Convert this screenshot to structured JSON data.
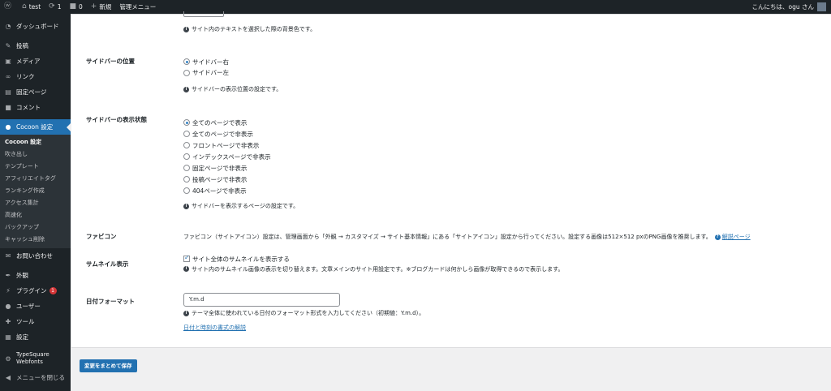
{
  "adminbar": {
    "site_name": "test",
    "updates_count": "1",
    "comments_count": "0",
    "new_label": "新規",
    "manage_menu_label": "管理メニュー",
    "greeting": "こんにちは、ogu さん"
  },
  "sidebar": {
    "items": [
      {
        "label": "ダッシュボード",
        "icon": "dashboard-icon"
      },
      {
        "label": "投稿",
        "icon": "pin-icon"
      },
      {
        "label": "メディア",
        "icon": "media-icon"
      },
      {
        "label": "リンク",
        "icon": "link-icon"
      },
      {
        "label": "固定ページ",
        "icon": "page-icon"
      },
      {
        "label": "コメント",
        "icon": "comment-icon"
      },
      {
        "label": "Cocoon 設定",
        "icon": "cocoon-icon"
      },
      {
        "label": "お問い合わせ",
        "icon": "mail-icon"
      },
      {
        "label": "外観",
        "icon": "appearance-icon"
      },
      {
        "label": "プラグイン",
        "icon": "plugin-icon",
        "badge": "1"
      },
      {
        "label": "ユーザー",
        "icon": "user-icon"
      },
      {
        "label": "ツール",
        "icon": "tools-icon"
      },
      {
        "label": "設定",
        "icon": "settings-icon"
      },
      {
        "label": "TypeSquare Webfonts",
        "icon": "gear-icon"
      },
      {
        "label": "メニューを閉じる",
        "icon": "collapse-icon"
      }
    ],
    "submenu": [
      "Cocoon 設定",
      "吹き出し",
      "テンプレート",
      "アフィリエイトタグ",
      "ランキング作成",
      "アクセス集計",
      "高速化",
      "バックアップ",
      "キャッシュ削除"
    ]
  },
  "settings": {
    "top_hint": "サイト内のテキストを選択した際の背景色です。",
    "sidebar_position": {
      "label": "サイドバーの位置",
      "options": [
        "サイドバー右",
        "サイドバー左"
      ],
      "selected_index": 0,
      "hint": "サイドバーの表示位置の設定です。"
    },
    "sidebar_display": {
      "label": "サイドバーの表示状態",
      "options": [
        "全てのページで表示",
        "全てのページで非表示",
        "フロントページで非表示",
        "インデックスページで非表示",
        "固定ページで非表示",
        "投稿ページで非表示",
        "404ページで非表示"
      ],
      "selected_index": 0,
      "hint": "サイドバーを表示するページの設定です。"
    },
    "favicon": {
      "label": "ファビコン",
      "text": "ファビコン（サイトアイコン）設定は、管理画面から「外観 → カスタマイズ → サイト基本情報」にある「サイトアイコン」設定から行ってください。設定する画像は512×512 pxのPNG画像を推奨します。",
      "link": "解説ページ"
    },
    "thumbnail": {
      "label": "サムネイル表示",
      "checkbox_label": "サイト全体のサムネイルを表示する",
      "checked": true,
      "hint": "サイト内のサムネイル画像の表示を切り替えます。文章メインのサイト用設定です。※ブログカードは何かしら画像が取得できるので表示します。"
    },
    "date_format": {
      "label": "日付フォーマット",
      "value": "Y.m.d",
      "hint": "テーマ全体に使われている日付のフォーマット形式を入力してください（初期値：Y.m.d）。",
      "link": "日付と時刻の書式の解説"
    }
  },
  "save_label": "変更をまとめて保存"
}
